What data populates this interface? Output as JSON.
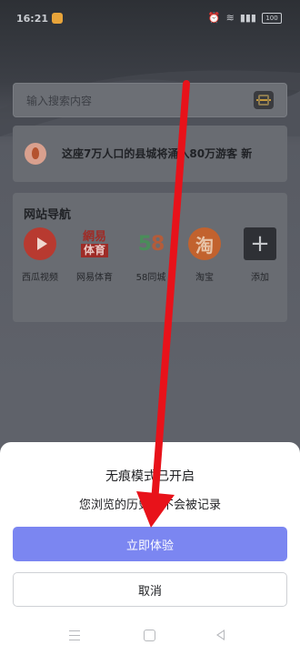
{
  "status_bar": {
    "time": "16:21",
    "battery": "100"
  },
  "search": {
    "placeholder": "输入搜索内容"
  },
  "news": {
    "headline": "这座7万人口的县城将涌入80万游客",
    "badge": "新"
  },
  "site_nav": {
    "title": "网站导航",
    "items": [
      {
        "label": "西瓜视频",
        "icon": "xigua-video-icon"
      },
      {
        "label": "网易体育",
        "icon": "netease-sports-icon",
        "logo_top": "網易",
        "logo_bottom": "体育"
      },
      {
        "label": "58同城",
        "icon": "58-tongcheng-icon",
        "logo_a": "5",
        "logo_b": "8"
      },
      {
        "label": "淘宝",
        "icon": "taobao-icon",
        "logo": "淘"
      },
      {
        "label": "添加",
        "icon": "add-icon",
        "logo": "+"
      }
    ]
  },
  "dialog": {
    "title": "无痕模式已开启",
    "message": "您浏览的历史将不会被记录",
    "primary_label": "立即体验",
    "cancel_label": "取消"
  },
  "colors": {
    "primary": "#7b86f1",
    "annotation_arrow": "#e8121a"
  }
}
